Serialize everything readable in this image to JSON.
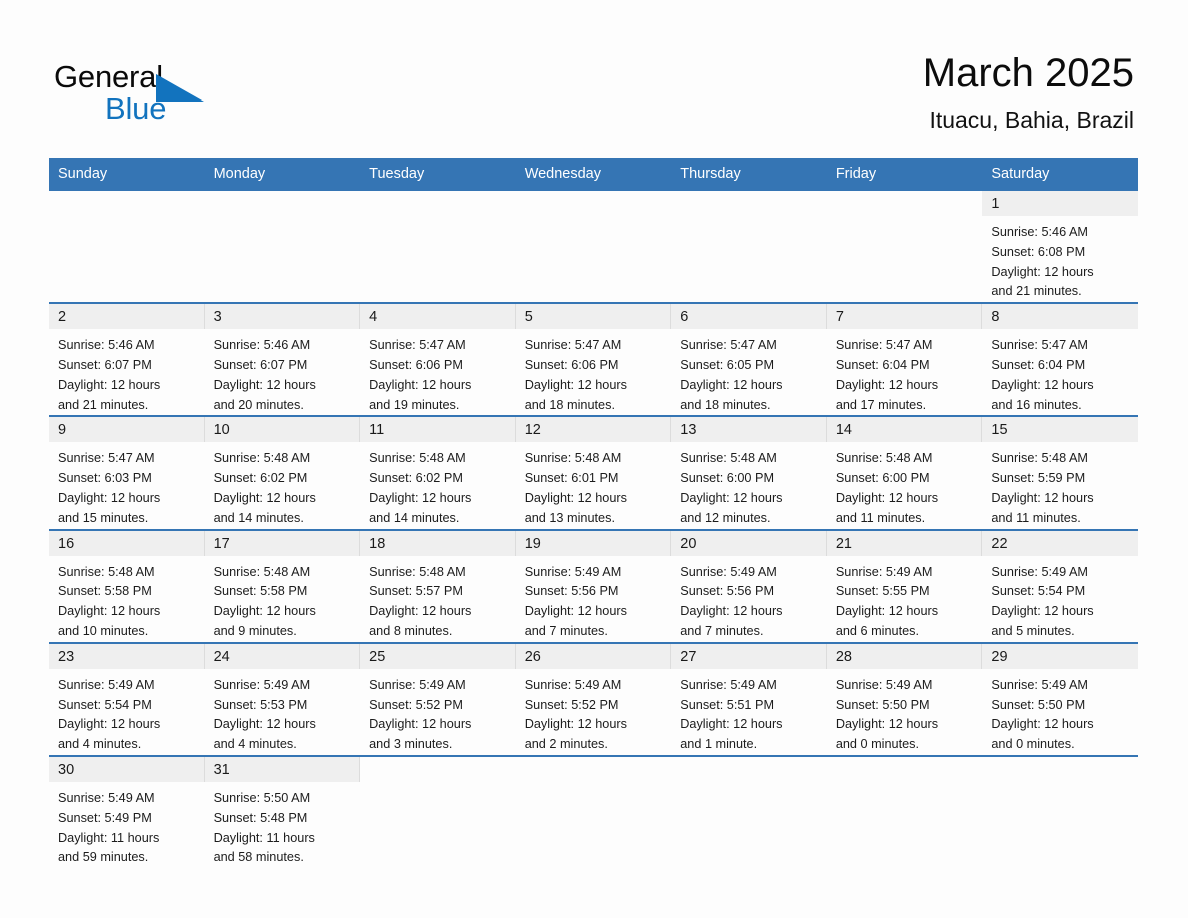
{
  "brand": {
    "word_general": "General",
    "word_blue": "Blue",
    "triangle_color": "#1273be"
  },
  "header": {
    "title": "March 2025",
    "location": "Ituacu, Bahia, Brazil"
  },
  "theme": {
    "header_blue": "#3575b4",
    "daynum_band": "#efefef",
    "page_bg": "#fdfdfd",
    "text": "#1c1c1c"
  },
  "weekdays": [
    "Sunday",
    "Monday",
    "Tuesday",
    "Wednesday",
    "Thursday",
    "Friday",
    "Saturday"
  ],
  "weeks": [
    [
      {
        "blank": true
      },
      {
        "blank": true
      },
      {
        "blank": true
      },
      {
        "blank": true
      },
      {
        "blank": true
      },
      {
        "blank": true
      },
      {
        "day": "1",
        "sunrise": "Sunrise: 5:46 AM",
        "sunset": "Sunset: 6:08 PM",
        "daylight_l1": "Daylight: 12 hours",
        "daylight_l2": "and 21 minutes."
      }
    ],
    [
      {
        "day": "2",
        "sunrise": "Sunrise: 5:46 AM",
        "sunset": "Sunset: 6:07 PM",
        "daylight_l1": "Daylight: 12 hours",
        "daylight_l2": "and 21 minutes."
      },
      {
        "day": "3",
        "sunrise": "Sunrise: 5:46 AM",
        "sunset": "Sunset: 6:07 PM",
        "daylight_l1": "Daylight: 12 hours",
        "daylight_l2": "and 20 minutes."
      },
      {
        "day": "4",
        "sunrise": "Sunrise: 5:47 AM",
        "sunset": "Sunset: 6:06 PM",
        "daylight_l1": "Daylight: 12 hours",
        "daylight_l2": "and 19 minutes."
      },
      {
        "day": "5",
        "sunrise": "Sunrise: 5:47 AM",
        "sunset": "Sunset: 6:06 PM",
        "daylight_l1": "Daylight: 12 hours",
        "daylight_l2": "and 18 minutes."
      },
      {
        "day": "6",
        "sunrise": "Sunrise: 5:47 AM",
        "sunset": "Sunset: 6:05 PM",
        "daylight_l1": "Daylight: 12 hours",
        "daylight_l2": "and 18 minutes."
      },
      {
        "day": "7",
        "sunrise": "Sunrise: 5:47 AM",
        "sunset": "Sunset: 6:04 PM",
        "daylight_l1": "Daylight: 12 hours",
        "daylight_l2": "and 17 minutes."
      },
      {
        "day": "8",
        "sunrise": "Sunrise: 5:47 AM",
        "sunset": "Sunset: 6:04 PM",
        "daylight_l1": "Daylight: 12 hours",
        "daylight_l2": "and 16 minutes."
      }
    ],
    [
      {
        "day": "9",
        "sunrise": "Sunrise: 5:47 AM",
        "sunset": "Sunset: 6:03 PM",
        "daylight_l1": "Daylight: 12 hours",
        "daylight_l2": "and 15 minutes."
      },
      {
        "day": "10",
        "sunrise": "Sunrise: 5:48 AM",
        "sunset": "Sunset: 6:02 PM",
        "daylight_l1": "Daylight: 12 hours",
        "daylight_l2": "and 14 minutes."
      },
      {
        "day": "11",
        "sunrise": "Sunrise: 5:48 AM",
        "sunset": "Sunset: 6:02 PM",
        "daylight_l1": "Daylight: 12 hours",
        "daylight_l2": "and 14 minutes."
      },
      {
        "day": "12",
        "sunrise": "Sunrise: 5:48 AM",
        "sunset": "Sunset: 6:01 PM",
        "daylight_l1": "Daylight: 12 hours",
        "daylight_l2": "and 13 minutes."
      },
      {
        "day": "13",
        "sunrise": "Sunrise: 5:48 AM",
        "sunset": "Sunset: 6:00 PM",
        "daylight_l1": "Daylight: 12 hours",
        "daylight_l2": "and 12 minutes."
      },
      {
        "day": "14",
        "sunrise": "Sunrise: 5:48 AM",
        "sunset": "Sunset: 6:00 PM",
        "daylight_l1": "Daylight: 12 hours",
        "daylight_l2": "and 11 minutes."
      },
      {
        "day": "15",
        "sunrise": "Sunrise: 5:48 AM",
        "sunset": "Sunset: 5:59 PM",
        "daylight_l1": "Daylight: 12 hours",
        "daylight_l2": "and 11 minutes."
      }
    ],
    [
      {
        "day": "16",
        "sunrise": "Sunrise: 5:48 AM",
        "sunset": "Sunset: 5:58 PM",
        "daylight_l1": "Daylight: 12 hours",
        "daylight_l2": "and 10 minutes."
      },
      {
        "day": "17",
        "sunrise": "Sunrise: 5:48 AM",
        "sunset": "Sunset: 5:58 PM",
        "daylight_l1": "Daylight: 12 hours",
        "daylight_l2": "and 9 minutes."
      },
      {
        "day": "18",
        "sunrise": "Sunrise: 5:48 AM",
        "sunset": "Sunset: 5:57 PM",
        "daylight_l1": "Daylight: 12 hours",
        "daylight_l2": "and 8 minutes."
      },
      {
        "day": "19",
        "sunrise": "Sunrise: 5:49 AM",
        "sunset": "Sunset: 5:56 PM",
        "daylight_l1": "Daylight: 12 hours",
        "daylight_l2": "and 7 minutes."
      },
      {
        "day": "20",
        "sunrise": "Sunrise: 5:49 AM",
        "sunset": "Sunset: 5:56 PM",
        "daylight_l1": "Daylight: 12 hours",
        "daylight_l2": "and 7 minutes."
      },
      {
        "day": "21",
        "sunrise": "Sunrise: 5:49 AM",
        "sunset": "Sunset: 5:55 PM",
        "daylight_l1": "Daylight: 12 hours",
        "daylight_l2": "and 6 minutes."
      },
      {
        "day": "22",
        "sunrise": "Sunrise: 5:49 AM",
        "sunset": "Sunset: 5:54 PM",
        "daylight_l1": "Daylight: 12 hours",
        "daylight_l2": "and 5 minutes."
      }
    ],
    [
      {
        "day": "23",
        "sunrise": "Sunrise: 5:49 AM",
        "sunset": "Sunset: 5:54 PM",
        "daylight_l1": "Daylight: 12 hours",
        "daylight_l2": "and 4 minutes."
      },
      {
        "day": "24",
        "sunrise": "Sunrise: 5:49 AM",
        "sunset": "Sunset: 5:53 PM",
        "daylight_l1": "Daylight: 12 hours",
        "daylight_l2": "and 4 minutes."
      },
      {
        "day": "25",
        "sunrise": "Sunrise: 5:49 AM",
        "sunset": "Sunset: 5:52 PM",
        "daylight_l1": "Daylight: 12 hours",
        "daylight_l2": "and 3 minutes."
      },
      {
        "day": "26",
        "sunrise": "Sunrise: 5:49 AM",
        "sunset": "Sunset: 5:52 PM",
        "daylight_l1": "Daylight: 12 hours",
        "daylight_l2": "and 2 minutes."
      },
      {
        "day": "27",
        "sunrise": "Sunrise: 5:49 AM",
        "sunset": "Sunset: 5:51 PM",
        "daylight_l1": "Daylight: 12 hours",
        "daylight_l2": "and 1 minute."
      },
      {
        "day": "28",
        "sunrise": "Sunrise: 5:49 AM",
        "sunset": "Sunset: 5:50 PM",
        "daylight_l1": "Daylight: 12 hours",
        "daylight_l2": "and 0 minutes."
      },
      {
        "day": "29",
        "sunrise": "Sunrise: 5:49 AM",
        "sunset": "Sunset: 5:50 PM",
        "daylight_l1": "Daylight: 12 hours",
        "daylight_l2": "and 0 minutes."
      }
    ],
    [
      {
        "day": "30",
        "sunrise": "Sunrise: 5:49 AM",
        "sunset": "Sunset: 5:49 PM",
        "daylight_l1": "Daylight: 11 hours",
        "daylight_l2": "and 59 minutes."
      },
      {
        "day": "31",
        "sunrise": "Sunrise: 5:50 AM",
        "sunset": "Sunset: 5:48 PM",
        "daylight_l1": "Daylight: 11 hours",
        "daylight_l2": "and 58 minutes."
      },
      {
        "blank": true
      },
      {
        "blank": true
      },
      {
        "blank": true
      },
      {
        "blank": true
      },
      {
        "blank": true
      }
    ]
  ]
}
